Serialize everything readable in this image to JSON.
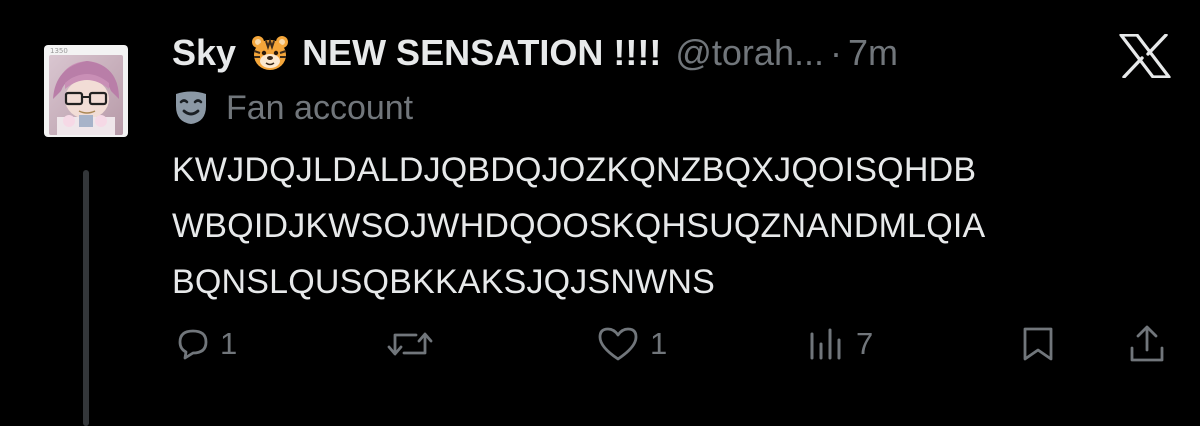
{
  "tweet": {
    "display_name": "Sky",
    "name_suffix": "NEW SENSATION !!!!",
    "handle": "@torah...",
    "separator": "·",
    "time": "7m",
    "account_label": "Fan account",
    "text_lines": [
      "KWJDQJLDALDJQBDQJOZKQNZBQXJQOISQHDB",
      "WBQIDJKWSOJWHDQOOSKQHSUQZNANDMLQIA",
      "BQNSLQUSQBKKAKSJQJSNWNS"
    ],
    "avatar_frame_tag": "1350"
  },
  "actions": {
    "reply_count": "1",
    "like_count": "1",
    "views_count": "7"
  },
  "icons": {
    "platform_logo": "x-logo-icon",
    "label_icon": "mask-icon",
    "name_emoji": "tiger-face-icon",
    "reply": "reply-icon",
    "repost": "repost-icon",
    "like": "heart-icon",
    "views": "views-bar-chart-icon",
    "bookmark": "bookmark-icon",
    "share": "share-icon"
  },
  "colors": {
    "background": "#000000",
    "primary_text": "#e7e9ea",
    "secondary_text": "#71767b",
    "thread_line": "#333639"
  }
}
